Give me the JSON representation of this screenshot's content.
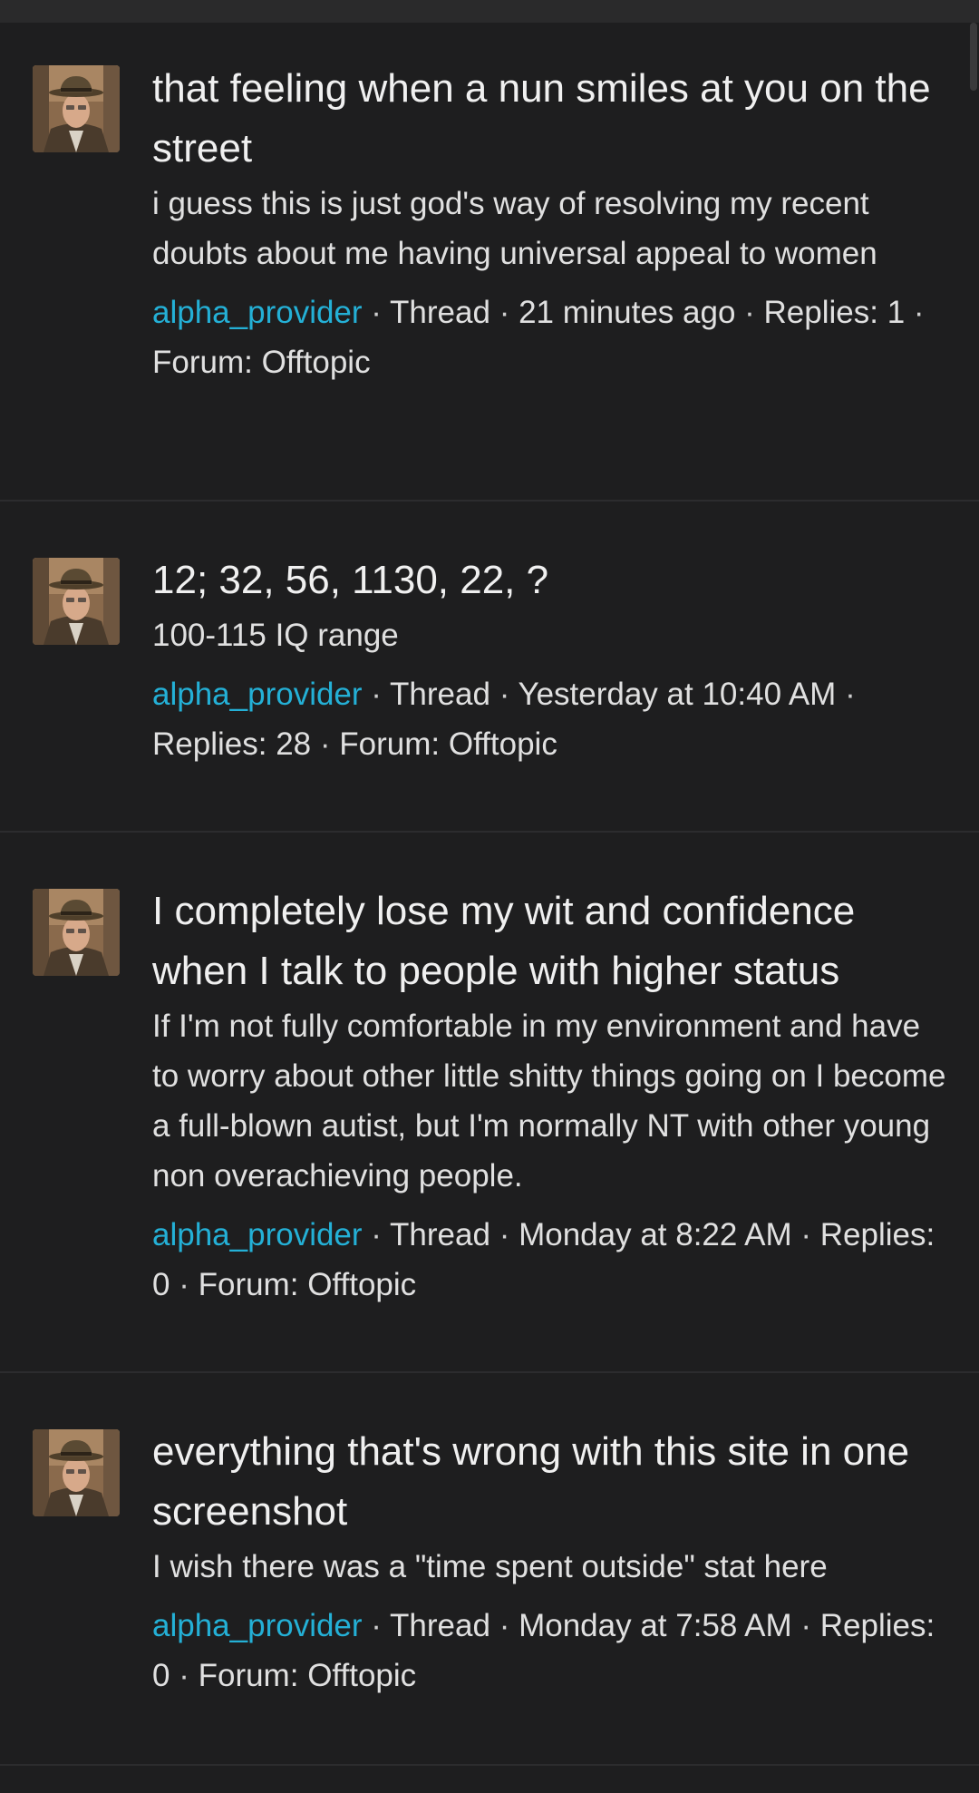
{
  "results": [
    {
      "title": "that feeling when a nun smiles at you on the street",
      "snippet": "i guess this is just god's way of resolving my recent doubts about me having universal appeal to women",
      "author": "alpha_provider",
      "type": "Thread",
      "time": "21 minutes ago",
      "replies_label": "Replies:",
      "replies": "1",
      "forum_label": "Forum:",
      "forum": "Offtopic"
    },
    {
      "title": "12; 32, 56, 1130, 22, ?",
      "snippet": "100-115 IQ range",
      "author": "alpha_provider",
      "type": "Thread",
      "time": "Yesterday at 10:40 AM",
      "replies_label": "Replies:",
      "replies": "28",
      "forum_label": "Forum:",
      "forum": "Offtopic"
    },
    {
      "title": "I completely lose my wit and confidence when I talk to people with higher status",
      "snippet": "If I'm not fully comfortable in my environment and have to worry about other little shitty things going on I become a full-blown autist, but I'm normally NT with other young non overachieving people.",
      "author": "alpha_provider",
      "type": "Thread",
      "time": "Monday at 8:22 AM",
      "replies_label": "Replies:",
      "replies": "0",
      "forum_label": "Forum:",
      "forum": "Offtopic"
    },
    {
      "title": "everything that's wrong with this site in one screenshot",
      "snippet": "I wish there was a \"time spent outside\" stat here",
      "author": "alpha_provider",
      "type": "Thread",
      "time": "Monday at 7:58 AM",
      "replies_label": "Replies:",
      "replies": "0",
      "forum_label": "Forum:",
      "forum": "Offtopic"
    }
  ],
  "separator": "·",
  "colors": {
    "background": "#1e1e1f",
    "author_link": "#24b0d6",
    "text": "#ececec",
    "divider": "#2c2c2e"
  }
}
